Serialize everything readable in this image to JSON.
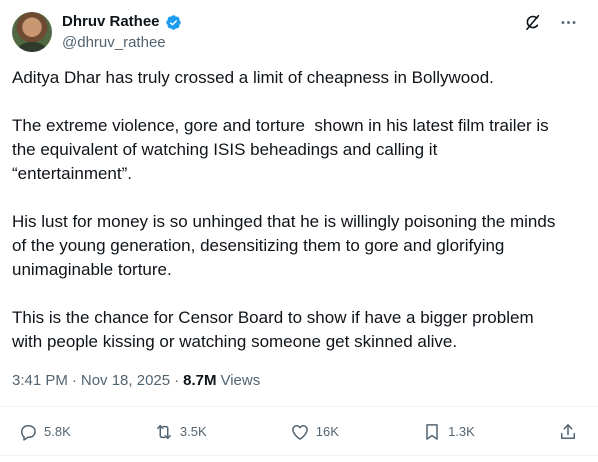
{
  "author": {
    "display_name": "Dhruv Rathee",
    "handle": "@dhruv_rathee",
    "verified": true,
    "verified_color": "#1d9bf0"
  },
  "icons": {
    "verified": "verified-badge-icon",
    "grok": "grok-icon",
    "more": "more-icon",
    "reply": "reply-icon",
    "repost": "repost-icon",
    "like": "like-icon",
    "bookmark": "bookmark-icon",
    "share": "share-icon"
  },
  "tweet": {
    "paragraphs": [
      "Aditya Dhar has truly crossed a limit of cheapness in Bollywood.",
      "The extreme violence, gore and torture  shown in his latest film trailer is\nthe equivalent of watching ISIS beheadings and calling it\n“entertainment”.",
      "His lust for money is so unhinged that he is willingly poisoning the minds\nof the young generation, desensitizing them to gore and glorifying\nunimaginable torture.",
      "This is the chance for Censor Board to show if have a bigger problem\nwith people kissing or watching someone get skinned alive."
    ],
    "time": "3:41 PM",
    "separator": "·",
    "date": "Nov 18, 2025",
    "views_count": "8.7M",
    "views_label": "Views"
  },
  "actions": {
    "replies": "5.8K",
    "reposts": "3.5K",
    "likes": "16K",
    "bookmarks": "1.3K"
  },
  "colors": {
    "text_primary": "#0f1419",
    "text_secondary": "#536471",
    "divider": "#eff3f4"
  }
}
